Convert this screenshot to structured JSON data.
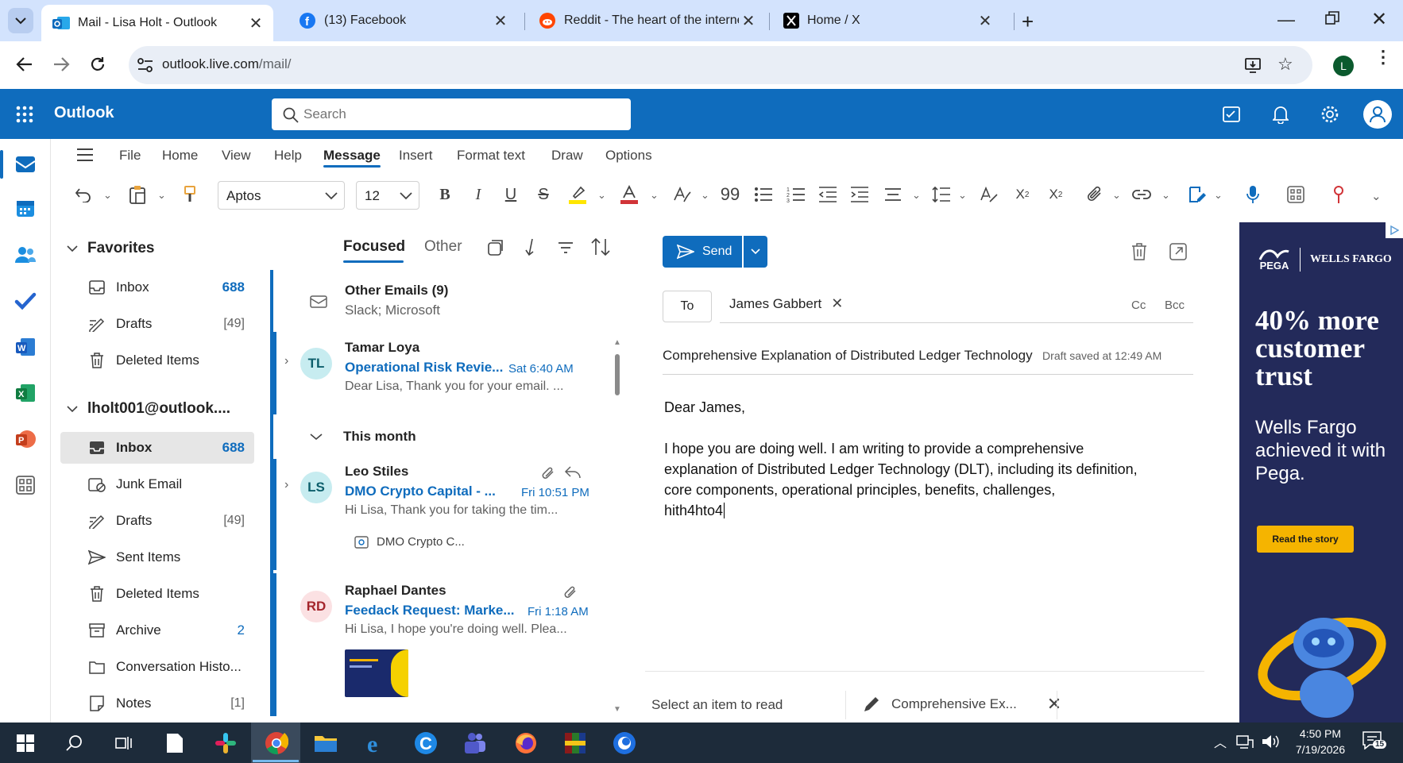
{
  "browser": {
    "tabs": [
      {
        "title": "Mail - Lisa Holt - Outlook",
        "active": true
      },
      {
        "title": "(13) Facebook",
        "active": false
      },
      {
        "title": "Reddit - The heart of the interne",
        "active": false
      },
      {
        "title": "Home / X",
        "active": false
      }
    ],
    "url_host": "outlook.live.com",
    "url_path": "/mail/",
    "profile_initial": "L"
  },
  "header": {
    "app_name": "Outlook",
    "search_placeholder": "Search"
  },
  "ribbon": {
    "menu": [
      "File",
      "Home",
      "View",
      "Help",
      "Message",
      "Insert",
      "Format text",
      "Draw",
      "Options"
    ],
    "active_menu": "Message",
    "font_name": "Aptos",
    "font_size": "12"
  },
  "folders": {
    "favorites_label": "Favorites",
    "favorites": [
      {
        "name": "Inbox",
        "count": "688",
        "icon": "inbox-icon"
      },
      {
        "name": "Drafts",
        "count": "[49]",
        "icon": "drafts-icon"
      },
      {
        "name": "Deleted Items",
        "count": "",
        "icon": "trash-icon"
      }
    ],
    "account_label": "lholt001@outlook....",
    "account": [
      {
        "name": "Inbox",
        "count": "688",
        "icon": "inbox-icon"
      },
      {
        "name": "Junk Email",
        "count": "",
        "icon": "junk-icon"
      },
      {
        "name": "Drafts",
        "count": "[49]",
        "icon": "drafts-icon"
      },
      {
        "name": "Sent Items",
        "count": "",
        "icon": "send-icon"
      },
      {
        "name": "Deleted Items",
        "count": "",
        "icon": "trash-icon"
      },
      {
        "name": "Archive",
        "count": "2",
        "icon": "archive-icon"
      },
      {
        "name": "Conversation Histo...",
        "count": "",
        "icon": "folder-icon"
      },
      {
        "name": "Notes",
        "count": "[1]",
        "icon": "notes-icon"
      }
    ]
  },
  "maillist": {
    "tab_focused": "Focused",
    "tab_other": "Other",
    "other_emails": {
      "title": "Other Emails (9)",
      "subtitle": "Slack; Microsoft"
    },
    "group_label": "This month",
    "items": [
      {
        "initials": "TL",
        "sender": "Tamar Loya",
        "subject": "Operational Risk Revie...",
        "time": "Sat 6:40 AM",
        "preview": "Dear Lisa, Thank you for your email. ..."
      },
      {
        "initials": "LS",
        "sender": "Leo Stiles",
        "subject": "DMO Crypto Capital - ...",
        "time": "Fri 10:51 PM",
        "preview": "Hi Lisa, Thank you for taking the tim...",
        "attachment": "DMO Crypto C..."
      },
      {
        "initials": "RD",
        "sender": "Raphael Dantes",
        "subject": "Feedack Request: Marke...",
        "time": "Fri 1:18 AM",
        "preview": "Hi Lisa, I hope you're doing well. Plea..."
      }
    ]
  },
  "compose": {
    "send_label": "Send",
    "to_label": "To",
    "recipient": "James Gabbert",
    "cc_label": "Cc",
    "bcc_label": "Bcc",
    "subject": "Comprehensive Explanation of Distributed Ledger Technology",
    "draft_status": "Draft saved at 12:49 AM",
    "body": [
      "Dear James,",
      "",
      "I hope you are doing well. I am writing to provide a comprehensive",
      "explanation of Distributed Ledger Technology (DLT), including its definition,",
      "core components, operational principles, benefits, challenges,",
      "hith4hto4"
    ]
  },
  "statusbar": {
    "reading_pane": "Select an item to read",
    "draft_tab": "Comprehensive Ex..."
  },
  "ad": {
    "brand1": "PEGA",
    "brand2": "WELLS FARGO",
    "headline": "40% more customer trust",
    "subtext": "Wells Fargo achieved it with Pega.",
    "cta": "Read the story"
  },
  "taskbar": {
    "time": "4:50 PM",
    "date": "7/19/2026",
    "notif_count": "15"
  },
  "colors": {
    "brand": "#0f6cbd",
    "tabbar": "#d3e3fd",
    "ad_bg": "#232a5a",
    "ad_cta": "#f5b400"
  }
}
